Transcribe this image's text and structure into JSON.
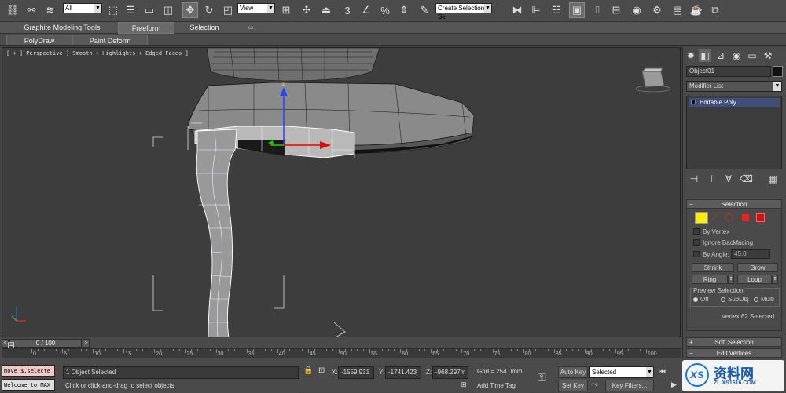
{
  "toolbar": {
    "selection_filter": "All",
    "reference_coord": "View",
    "named_selection": "Create Selection Se",
    "icons": [
      "link-icon",
      "unlink-icon",
      "bind-space-warp-icon",
      "select-object-icon",
      "select-by-name-icon",
      "rect-selection-icon",
      "window-crossing-icon",
      "select-move-icon",
      "select-rotate-icon",
      "select-scale-icon",
      "use-pivot-icon",
      "select-manipulate-icon",
      "keyboard-shortcut-icon",
      "snaps-toggle-icon",
      "angle-snap-icon",
      "percent-snap-icon",
      "spinner-snap-icon",
      "edit-named-selection-icon",
      "mirror-icon",
      "align-icon",
      "layer-manager-icon",
      "graphite-toggle-icon",
      "curve-editor-icon",
      "schematic-view-icon",
      "material-editor-icon",
      "render-setup-icon",
      "rendered-frame-icon",
      "render-production-icon",
      "render-iterative-icon"
    ]
  },
  "ribbon": {
    "tabs": [
      "Graphite Modeling Tools",
      "Freeform",
      "Selection"
    ],
    "active_tab": "Freeform",
    "sub_buttons": [
      "PolyDraw",
      "Paint Deform"
    ]
  },
  "viewport": {
    "label": "[ + ] Perspective ] Smooth + Highlights + Edged Faces ]"
  },
  "command_panel": {
    "object_name": "Object01",
    "object_color": "#111111",
    "modifier_list": "Modifier List",
    "stack_item": "Editable Poly",
    "selection_rollout": {
      "title": "Selection",
      "by_vertex": "By Vertex",
      "ignore_backfacing": "Ignore Backfacing",
      "by_angle": "By Angle:",
      "angle_value": "45.0",
      "shrink": "Shrink",
      "grow": "Grow",
      "ring": "Ring",
      "loop": "Loop",
      "preview_selection": "Preview Selection",
      "preview_off": "Off",
      "preview_subobj": "SubObj",
      "preview_multi": "Multi",
      "status": "Vertex 62 Selected"
    },
    "soft_selection": "Soft Selection",
    "edit_vertices": "Edit Vertices"
  },
  "timeline": {
    "slider_label": "0 / 100",
    "ticks": [
      "0",
      "5",
      "10",
      "15",
      "20",
      "25",
      "30",
      "35",
      "40",
      "45",
      "50",
      "55",
      "60",
      "65",
      "70",
      "75",
      "80",
      "85",
      "90",
      "95",
      "100"
    ]
  },
  "status": {
    "maxscript_top": "move $.selecte",
    "maxscript_bottom": "Welcome to MAX",
    "selection_status": "1 Object Selected",
    "prompt": "Click or click-and-drag to select objects",
    "x_label": "X:",
    "x_value": "-1559.931",
    "y_label": "Y:",
    "y_value": "-1741.423",
    "z_label": "Z:",
    "z_value": "-968.297m",
    "grid": "Grid = 254.0mm",
    "add_time_tag": "Add Time Tag",
    "auto_key": "Auto Key",
    "key_mode": "Selected",
    "set_key": "Set Key",
    "key_filters": "Key Filters...",
    "watermark_text": "资料网",
    "watermark_url": "ZL.XS1616.COM"
  }
}
